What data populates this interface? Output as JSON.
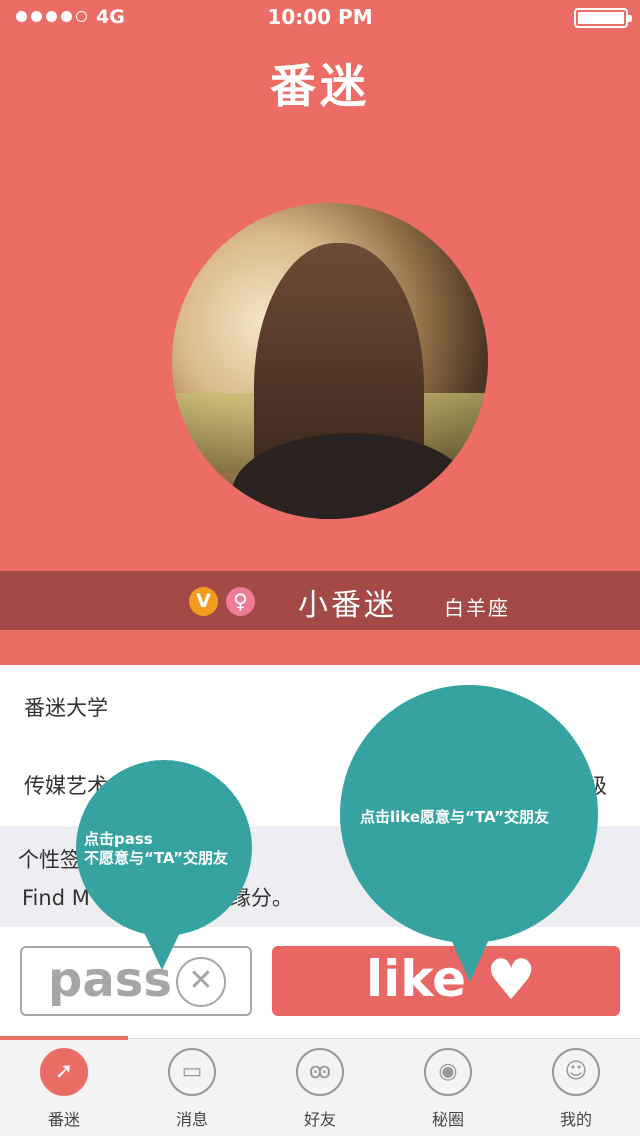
{
  "status_bar": {
    "carrier": "4G",
    "time": "10:00 PM",
    "signal_filled": 4,
    "signal_total": 5,
    "battery_level": 1.0
  },
  "app": {
    "title": "番迷"
  },
  "profile": {
    "avatar_icon": "user-photo",
    "v_badge": "V",
    "gender_symbol": "♀",
    "gender": "female",
    "name": "小番迷",
    "zodiac": "白羊座",
    "school": "番迷大学",
    "department": "传媒艺术",
    "grade_suffix": "级",
    "signature_label": "个性签",
    "signature_text": "Find M",
    "signature_tail": "缘分。"
  },
  "actions": {
    "pass_label": "pass",
    "pass_icon": "close-circle-icon",
    "like_label": "like",
    "like_icon": "heart-icon"
  },
  "tooltips": {
    "pass_line1": "点击pass",
    "pass_line2": "不愿意与“TA”交朋友",
    "like_text": "点击like愿意与“TA”交朋友"
  },
  "tabs": [
    {
      "label": "番迷",
      "icon": "compass-icon",
      "active": true
    },
    {
      "label": "消息",
      "icon": "chat-bubble-icon",
      "active": false
    },
    {
      "label": "好友",
      "icon": "friends-icon",
      "active": false
    },
    {
      "label": "秘圈",
      "icon": "ninja-icon",
      "active": false
    },
    {
      "label": "我的",
      "icon": "person-icon",
      "active": false
    }
  ],
  "colors": {
    "primary": "#ec6d66",
    "name_bar": "#a34a46",
    "tooltip": "#36a3a0",
    "like_button": "#e86663",
    "v_badge": "#f39b1e",
    "gender_badge": "#ee7e97"
  }
}
